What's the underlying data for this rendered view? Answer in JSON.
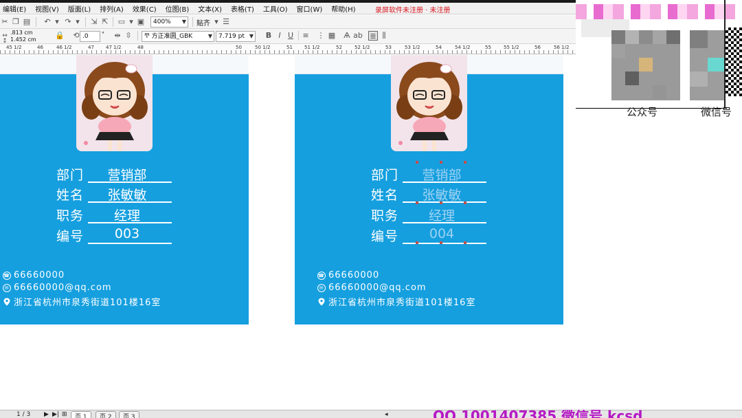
{
  "menu": {
    "items": [
      "编辑(E)",
      "视图(V)",
      "版面(L)",
      "排列(A)",
      "效果(C)",
      "位图(B)",
      "文本(X)",
      "表格(T)",
      "工具(O)",
      "窗口(W)",
      "帮助(H)"
    ],
    "banner": "录屏软件未注册 · 未注册"
  },
  "toolbar1": {
    "zoom": "400%",
    "snap_label": "贴齐"
  },
  "toolbar2": {
    "width_value": ".813 cm",
    "height_value": "1.452 cm",
    "angle_value": ".0",
    "font_name": "方正准圆_GBK",
    "font_size": "7.719 pt"
  },
  "ruler": {
    "labels": [
      "45 1/2",
      "46",
      "46 1/2",
      "47",
      "47 1/2",
      "48",
      "50",
      "50 1/2",
      "51",
      "51 1/2",
      "52",
      "52 1/2",
      "53",
      "53 1/2",
      "54",
      "54 1/2",
      "55",
      "55 1/2",
      "56",
      "56 1/2"
    ]
  },
  "cards": {
    "left": {
      "fields": [
        {
          "label": "部门",
          "value": "营销部"
        },
        {
          "label": "姓名",
          "value": "张敏敏"
        },
        {
          "label": "职务",
          "value": "经理"
        },
        {
          "label": "编号",
          "value": "003"
        }
      ],
      "phone": "66660000",
      "email": "66660000@qq.com",
      "address": "浙江省杭州市泉秀街道101楼16室"
    },
    "right": {
      "fields": [
        {
          "label": "部门",
          "value": "营销部"
        },
        {
          "label": "姓名",
          "value": "张敏敏"
        },
        {
          "label": "职务",
          "value": "经理"
        },
        {
          "label": "编号",
          "value": "004"
        }
      ],
      "phone": "66660000",
      "email": "66660000@qq.com",
      "address": "浙江省杭州市泉秀街道101楼16室"
    }
  },
  "overlay": {
    "label_left": "公众号",
    "label_right": "微信号"
  },
  "status": {
    "page_indicator": "1 / 3",
    "tabs": [
      "页 1",
      "页 2",
      "页 3"
    ]
  },
  "bottom_banner": "QQ 1001407385  微信号 kcsd"
}
